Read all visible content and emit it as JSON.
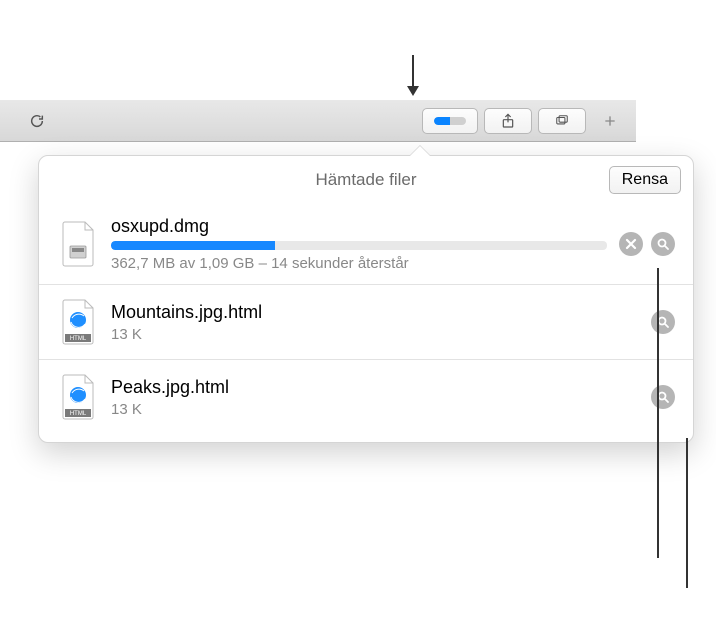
{
  "popover": {
    "title": "Hämtade filer",
    "clear_label": "Rensa"
  },
  "downloads": [
    {
      "name": "osxupd.dmg",
      "meta": "362,7 MB av 1,09 GB   –   14 sekunder återstår",
      "progress_pct": 33,
      "in_progress": true,
      "icon": "dmg"
    },
    {
      "name": "Mountains.jpg.html",
      "meta": "13 K",
      "in_progress": false,
      "icon": "html"
    },
    {
      "name": "Peaks.jpg.html",
      "meta": "13 K",
      "in_progress": false,
      "icon": "html"
    }
  ]
}
